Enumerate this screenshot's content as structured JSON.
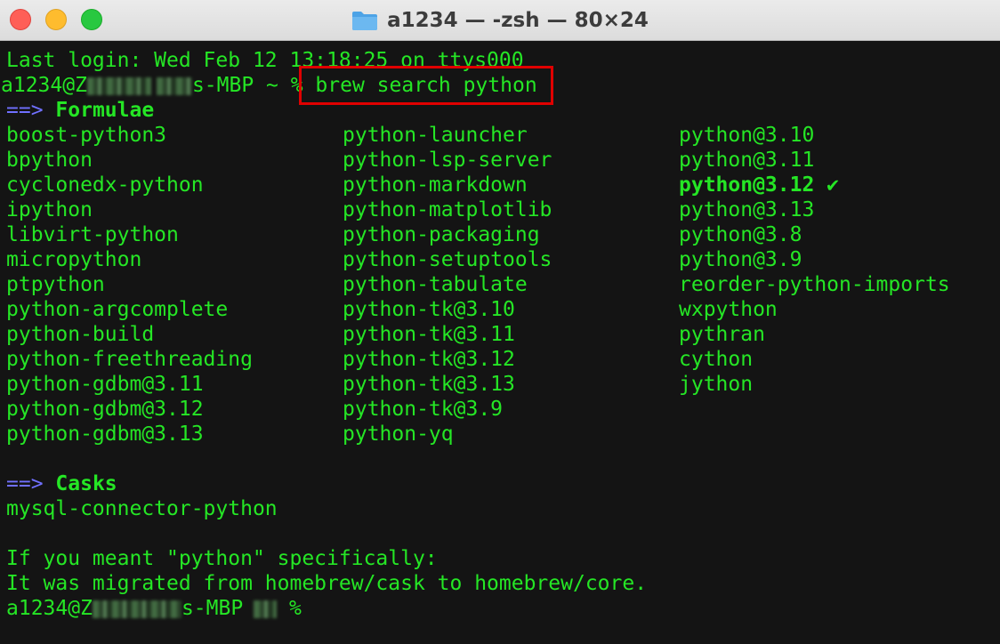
{
  "window": {
    "title": "a1234 — -zsh — 80×24"
  },
  "terminal": {
    "last_login": "Last login: Wed Feb 12 13:18:25 on ttys000",
    "prompt_user": "a1234@Z",
    "prompt_host_suffix": "s-MBP ~ % ",
    "command": "brew search python",
    "formulae_arrow": "==>",
    "formulae_heading": "Formulae",
    "formulae_col1": [
      "boost-python3",
      "bpython",
      "cyclonedx-python",
      "ipython",
      "libvirt-python",
      "micropython",
      "ptpython",
      "python-argcomplete",
      "python-build",
      "python-freethreading",
      "python-gdbm@3.11",
      "python-gdbm@3.12",
      "python-gdbm@3.13"
    ],
    "formulae_col2": [
      "python-launcher",
      "python-lsp-server",
      "python-markdown",
      "python-matplotlib",
      "python-packaging",
      "python-setuptools",
      "python-tabulate",
      "python-tk@3.10",
      "python-tk@3.11",
      "python-tk@3.12",
      "python-tk@3.13",
      "python-tk@3.9",
      "python-yq"
    ],
    "formulae_col3": [
      "python@3.10",
      "python@3.11",
      "python@3.12 ✔",
      "python@3.13",
      "python@3.8",
      "python@3.9",
      "reorder-python-imports",
      "wxpython",
      "pythran",
      "cython",
      "jython"
    ],
    "installed_item_index": 2,
    "casks_arrow": "==>",
    "casks_heading": "Casks",
    "casks": [
      "mysql-connector-python"
    ],
    "note_line1": "If you meant \"python\" specifically:",
    "note_line2": "It was migrated from homebrew/cask to homebrew/core.",
    "final_prompt_user": "a1234@Z",
    "final_prompt_host_suffix": "s-MBP",
    "final_prompt_end": " %"
  },
  "colors": {
    "text": "#25e625",
    "arrow": "#7070ff",
    "background": "#141414",
    "highlight": "#e00000"
  }
}
